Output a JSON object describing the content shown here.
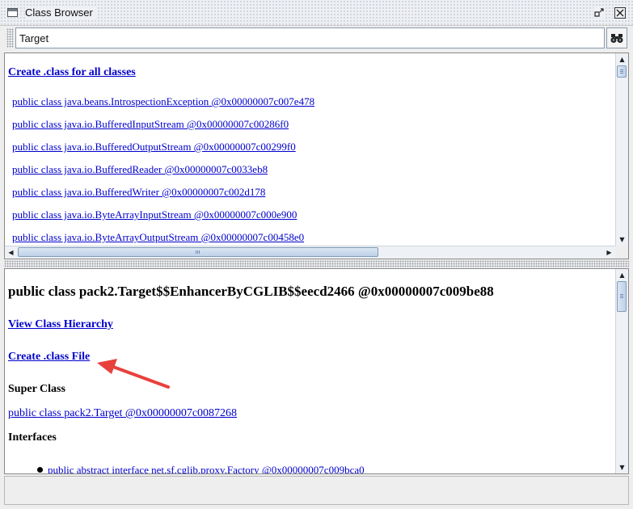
{
  "window": {
    "title": "Class Browser"
  },
  "search": {
    "value": "Target"
  },
  "top_pane": {
    "create_all_link": "Create .class for all classes",
    "classes": [
      "public class java.beans.IntrospectionException @0x00000007c007e478",
      "public class java.io.BufferedInputStream @0x00000007c00286f0",
      "public class java.io.BufferedOutputStream @0x00000007c00299f0",
      "public class java.io.BufferedReader @0x00000007c0033eb8",
      "public class java.io.BufferedWriter @0x00000007c002d178",
      "public class java.io.ByteArrayInputStream @0x00000007c000e900",
      "public class java.io.ByteArrayOutputStream @0x00000007c00458e0"
    ]
  },
  "detail": {
    "title": "public class pack2.Target$$EnhancerByCGLIB$$eecd2466 @0x00000007c009be88",
    "view_hierarchy": "View Class Hierarchy",
    "create_class_file": "Create .class File",
    "super_class_heading": "Super Class",
    "super_class_link": "public class pack2.Target @0x00000007c0087268",
    "interfaces_heading": "Interfaces",
    "interfaces": [
      "public abstract interface net.sf.cglib.proxy.Factory @0x00000007c009bca0"
    ]
  },
  "icons": {
    "window": "window-icon",
    "restore": "restore-icon",
    "close": "close-icon",
    "find": "binoculars-icon"
  },
  "colors": {
    "link": "#0000cc",
    "annotation_arrow": "#e8413c",
    "scroll_thumb": "#bfd1e8"
  }
}
